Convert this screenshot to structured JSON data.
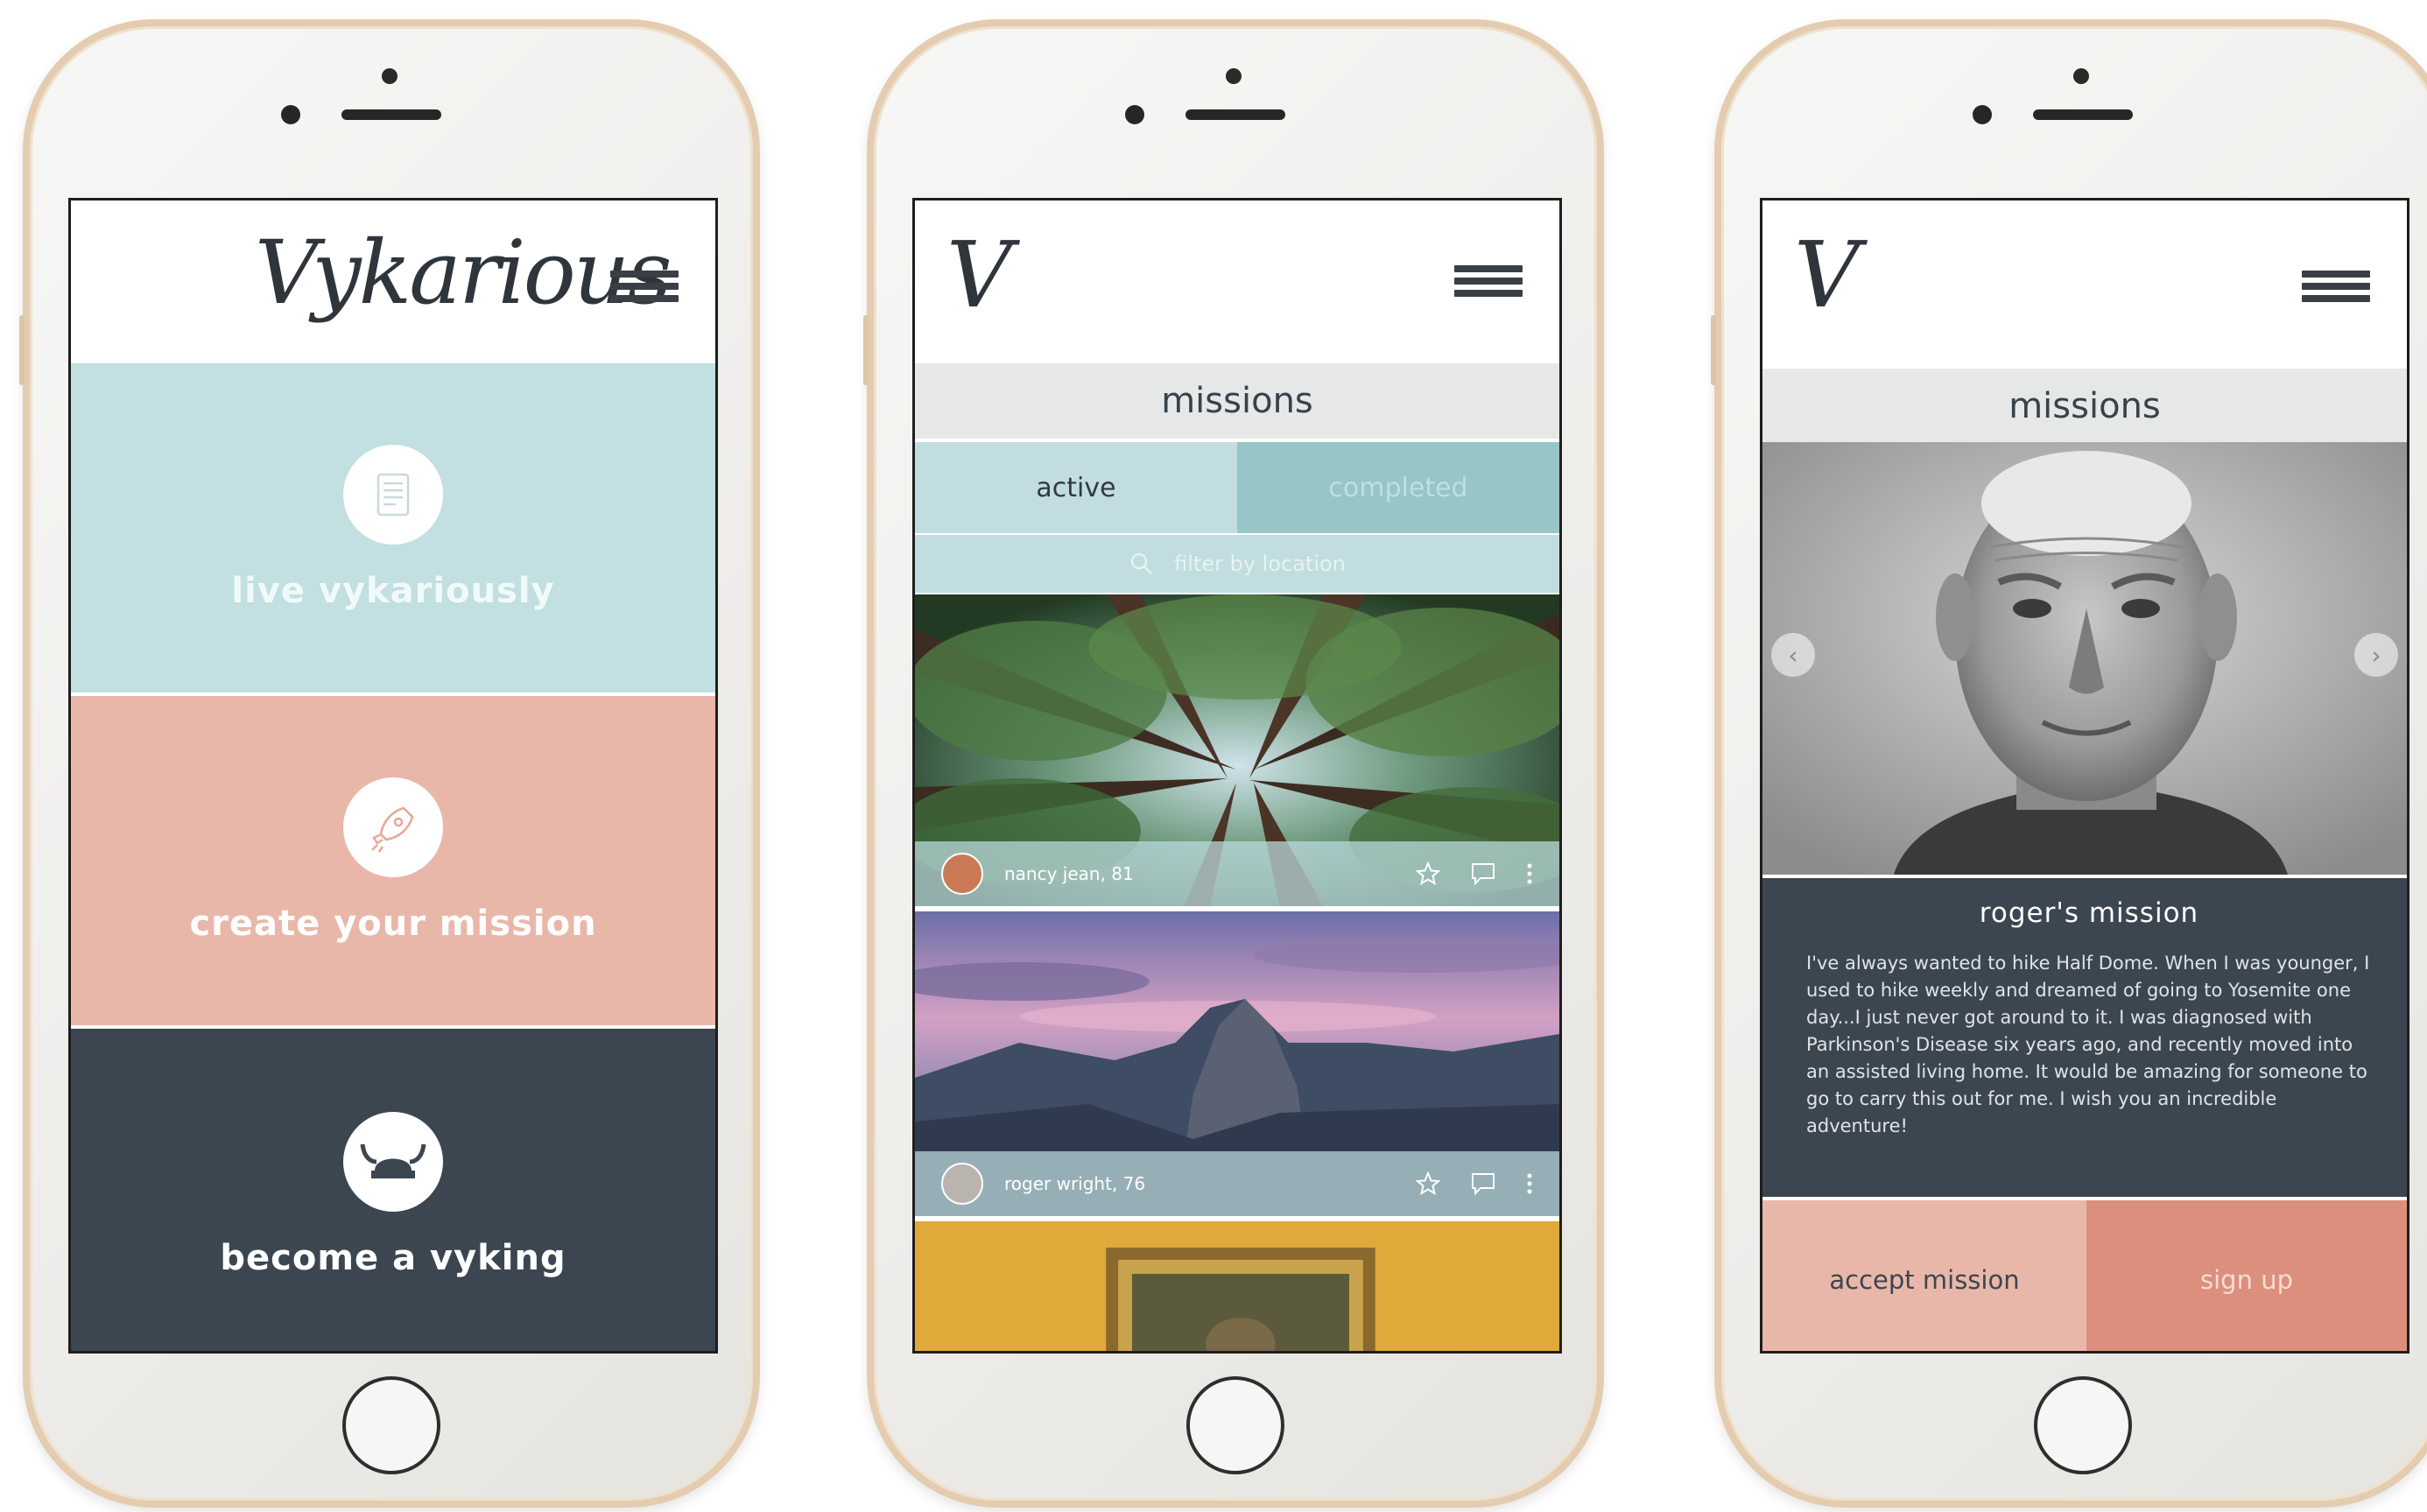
{
  "colors": {
    "teal_light": "#c2dfe1",
    "teal_mid": "#97c5c8",
    "salmon": "#e9b7a9",
    "salmon_dark": "#db8f7c",
    "slate": "#3b4650",
    "gold_frame": "#e3ccb0"
  },
  "home": {
    "logo": "Vykarious",
    "tiles": [
      {
        "label": "live vykariously",
        "icon": "checklist-icon"
      },
      {
        "label": "create your mission",
        "icon": "rocket-icon"
      },
      {
        "label": "become a vyking",
        "icon": "viking-helmet-icon"
      }
    ]
  },
  "missions": {
    "logo_mark": "V",
    "title": "missions",
    "tabs": [
      {
        "label": "active",
        "selected": true
      },
      {
        "label": "completed",
        "selected": false
      }
    ],
    "filter_placeholder": "filter by location",
    "cards": [
      {
        "user": "nancy jean, 81",
        "image": "redwood-forest"
      },
      {
        "user": "roger wright, 76",
        "image": "half-dome-dusk"
      },
      {
        "user": "",
        "image": "framed-painting"
      }
    ]
  },
  "detail": {
    "logo_mark": "V",
    "title": "missions",
    "mission_title": "roger's mission",
    "story": "I've always wanted to hike Half Dome. When I was younger, I used to hike weekly and dreamed of going to Yosemite one day...I just never got around to it. I was diagnosed with Parkinson's Disease six years ago, and recently moved into an assisted living home. It would be amazing for someone to go to carry this out for me. I wish you an incredible adventure!",
    "accept_label": "accept mission",
    "signup_label": "sign up"
  }
}
